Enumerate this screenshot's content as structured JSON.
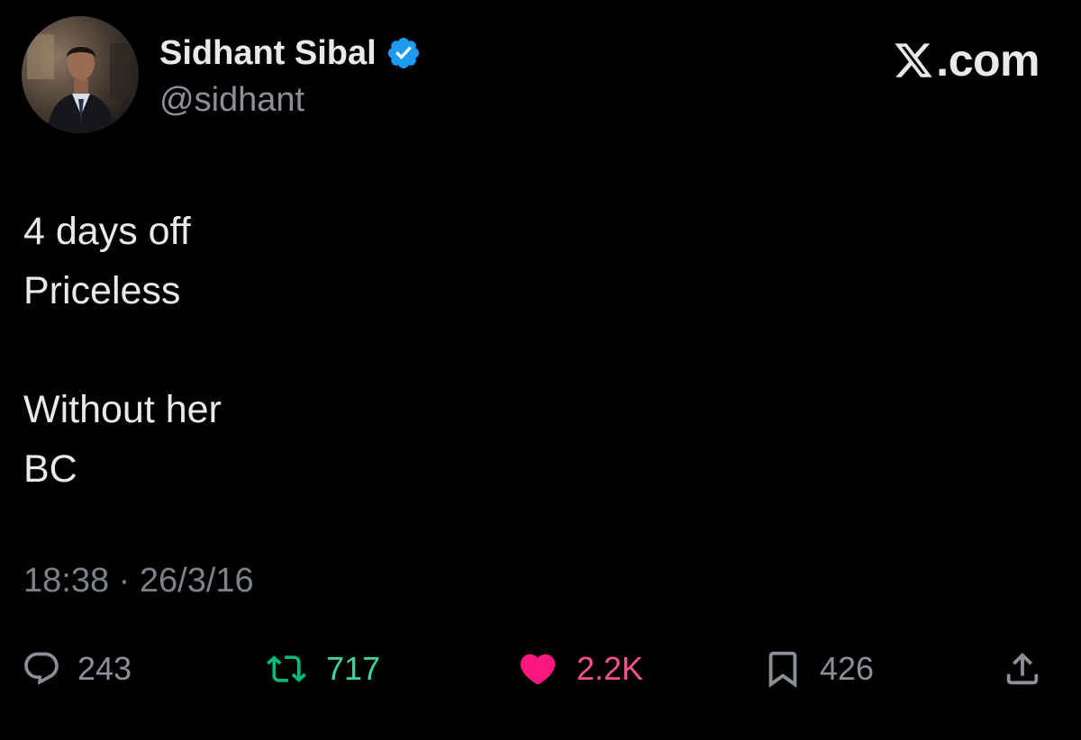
{
  "author": {
    "display_name": "Sidhant Sibal",
    "handle": "@sidhant",
    "verified": true,
    "avatar_icon": "profile-photo"
  },
  "brand": {
    "label": ".com",
    "icon": "x-logo-icon"
  },
  "post": {
    "lines": [
      "4 days off",
      "Priceless",
      "",
      "Without her",
      "BC"
    ],
    "timestamp": "18:38 · 26/3/16"
  },
  "actions": {
    "replies": "243",
    "reposts": "717",
    "likes": "2.2K",
    "bookmarks": "426",
    "share_icon": "share-icon"
  },
  "colors": {
    "background": "#000000",
    "text": "#e7e9ea",
    "muted": "#8b9097",
    "verified": "#1d9bf0",
    "repost": "#00ba7c",
    "like": "#f91880"
  }
}
